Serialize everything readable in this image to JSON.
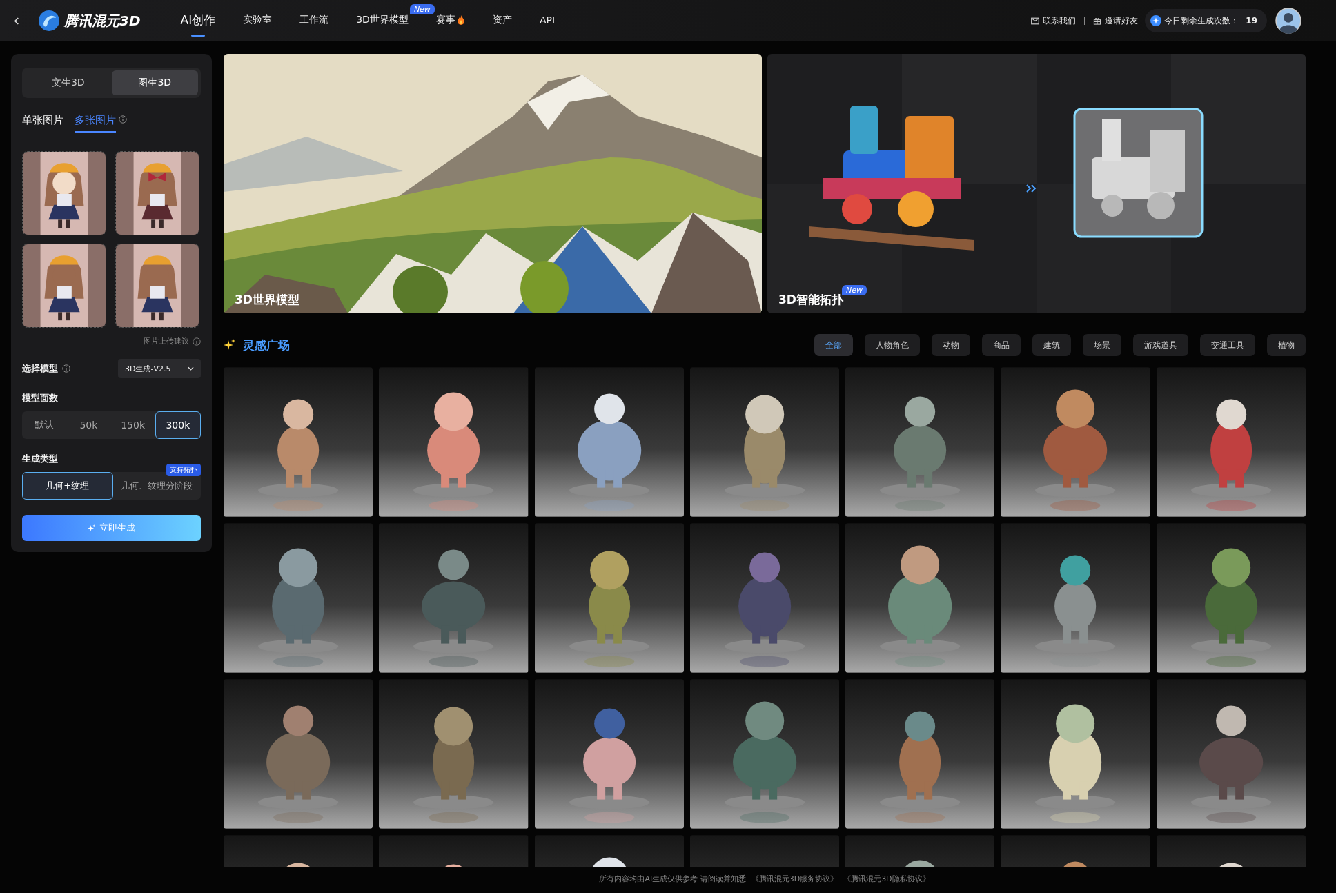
{
  "nav": {
    "logo_text": "腾讯混元3D",
    "items": [
      {
        "label": "AI创作",
        "selected": true,
        "kind": "plain"
      },
      {
        "label": "实验室",
        "selected": false,
        "kind": "plain"
      },
      {
        "label": "工作流",
        "selected": false,
        "kind": "plain"
      },
      {
        "label": "3D世界模型",
        "selected": false,
        "kind": "plain",
        "badge": "New"
      },
      {
        "label": "赛事",
        "selected": false,
        "kind": "hot"
      },
      {
        "label": "资产",
        "selected": false,
        "kind": "plain"
      },
      {
        "label": "API",
        "selected": false,
        "kind": "plain"
      }
    ]
  },
  "account": {
    "contact": "联系我们",
    "invite": "邀请好友",
    "quota_label": "今日剩余生成次数：",
    "quota": "19"
  },
  "panel": {
    "modes": [
      {
        "label": "文生3D",
        "selected": false
      },
      {
        "label": "图生3D",
        "selected": true
      }
    ],
    "sources": [
      {
        "label": "单张图片",
        "selected": false,
        "info": false
      },
      {
        "label": "多张图片",
        "selected": true,
        "info": true
      }
    ],
    "upload_hint": "图片上传建议",
    "model_label": "选择模型",
    "model_value": "3D生成-V2.5",
    "faces_label": "模型面数",
    "faces": [
      {
        "label": "默认",
        "selected": false
      },
      {
        "label": "50k",
        "selected": false
      },
      {
        "label": "150k",
        "selected": false
      },
      {
        "label": "300k",
        "selected": true
      }
    ],
    "type_label": "生成类型",
    "types": [
      {
        "label": "几何+纹理",
        "selected": true
      },
      {
        "label": "几何、纹理分阶段",
        "selected": false,
        "badge": "支持拓扑"
      }
    ],
    "generate": "立即生成"
  },
  "banners": [
    {
      "title": "3D世界模型",
      "kind": "landscape"
    },
    {
      "title": "3D智能拓扑",
      "kind": "topology",
      "badge": "New"
    }
  ],
  "inspiration": {
    "title": "灵感广场",
    "categories": [
      {
        "label": "全部",
        "selected": true
      },
      {
        "label": "人物角色",
        "selected": false
      },
      {
        "label": "动物",
        "selected": false
      },
      {
        "label": "商品",
        "selected": false
      },
      {
        "label": "建筑",
        "selected": false
      },
      {
        "label": "场景",
        "selected": false
      },
      {
        "label": "游戏道具",
        "selected": false
      },
      {
        "label": "交通工具",
        "selected": false
      },
      {
        "label": "植物",
        "selected": false
      }
    ]
  },
  "footer": {
    "text": "所有内容均由AI生成仅供参考 请阅读并知悉",
    "links": [
      "《腾讯混元3D服务协议》",
      "《腾讯混元3D隐私协议》"
    ]
  }
}
